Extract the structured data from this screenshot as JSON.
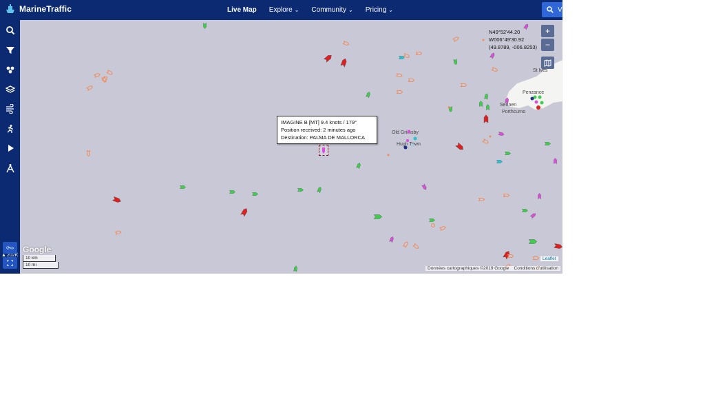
{
  "app": {
    "title": "MarineTraffic"
  },
  "nav": {
    "live_map": "Live Map",
    "explore": "Explore",
    "community": "Community",
    "pricing": "Pricing"
  },
  "search": {
    "hint": "V"
  },
  "sidebar": {
    "tools": [
      "search-icon",
      "filter-icon",
      "density-icon",
      "layers-icon",
      "weather-icon",
      "events-icon",
      "playback-icon",
      "measure-icon"
    ],
    "vessel_count": "202K"
  },
  "map": {
    "coords": {
      "lat": "N49°52'44.20",
      "lon": "W006°49'30.92",
      "decimal": "(49.8789, -006.8253)"
    },
    "zoom_in": "+",
    "zoom_out": "−",
    "places": {
      "st_ives": "St Ives",
      "penzance": "Penzance",
      "sennen": "Sennen",
      "porthcurno": "Porthcurno",
      "old_grimsby": "Old Grimsby",
      "hugh_town": "Hugh Town"
    },
    "google": "Google",
    "scale_km": "10 km",
    "scale_mi": "10 mi",
    "attribution": "Données cartographiques ©2019 Google",
    "terms": "Conditions d'utilisation",
    "leaflet": "Leaflet"
  },
  "tooltip": {
    "line1": "IMAGINE B [MT] 9.4 knots / 179°",
    "line2": "Position received: 2 minutes ago",
    "line3": "Destination: PALMA DE MALLORCA"
  },
  "colors": {
    "bar": "#0b2a72",
    "sea": "#c9c8d6",
    "cargo": "#3bcf4a",
    "tanker": "#e0201f",
    "passenger": "#2bc2d0",
    "fishing": "#f08c5a",
    "pleasure": "#d94fdb"
  }
}
